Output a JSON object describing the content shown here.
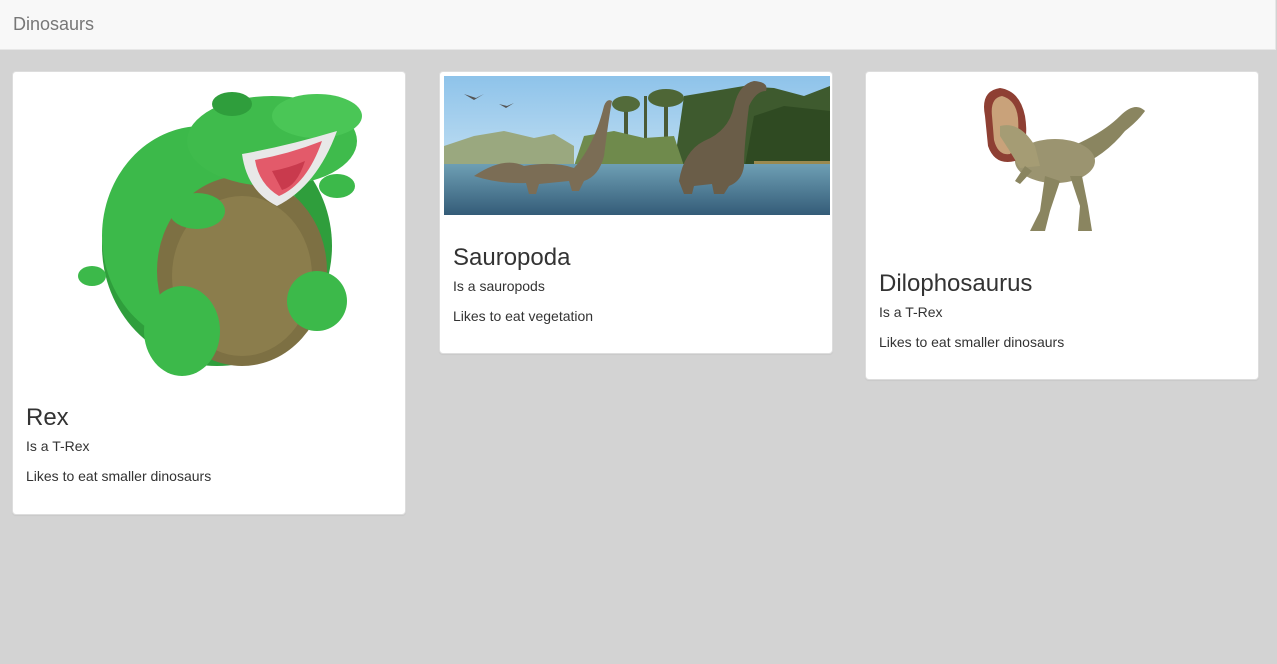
{
  "navbar": {
    "brand": "Dinosaurs"
  },
  "cards": [
    {
      "title": "Rex",
      "line1": "Is a T-Rex",
      "line2": "Likes to eat smaller dinosaurs",
      "image": "green-plush-t-rex"
    },
    {
      "title": "Sauropoda",
      "line1": "Is a sauropods",
      "line2": "Likes to eat vegetation",
      "image": "sauropods-in-lake"
    },
    {
      "title": "Dilophosaurus",
      "line1": "Is a T-Rex",
      "line2": "Likes to eat smaller dinosaurs",
      "image": "dilophosaurus-figure"
    }
  ]
}
